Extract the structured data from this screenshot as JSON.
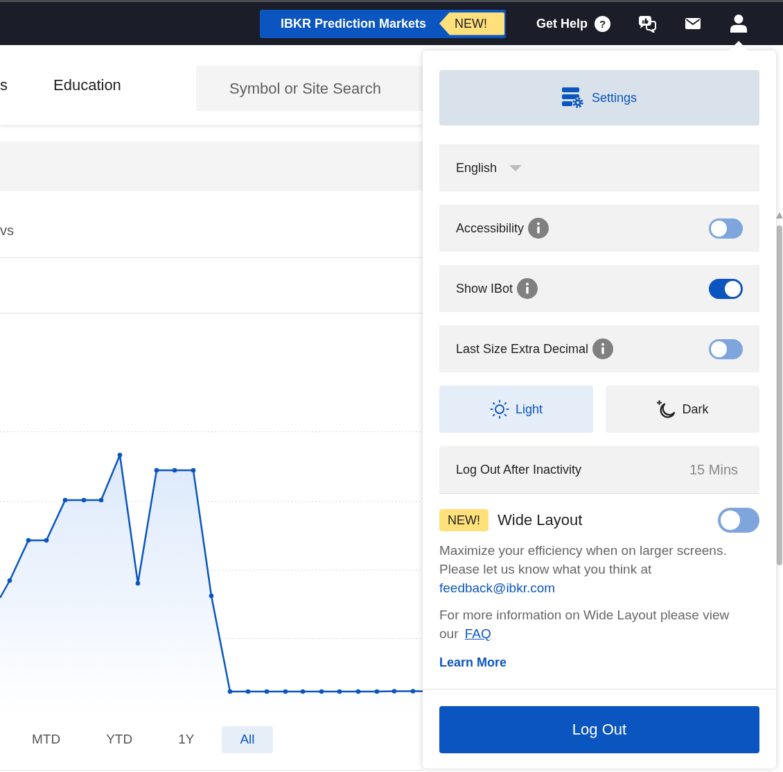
{
  "top_bar": {
    "promo_button": {
      "label": "IBKR Prediction Markets",
      "badge": "NEW!"
    },
    "help_link": {
      "label": "Get Help",
      "icon": "?"
    }
  },
  "nav": {
    "items": [
      {
        "label": "s"
      },
      {
        "label": "Education"
      }
    ],
    "search": {
      "placeholder": "Symbol or Site Search"
    }
  },
  "content": {
    "label_fragment": "vs",
    "range_buttons": [
      {
        "label": "MTD",
        "selected": false
      },
      {
        "label": "YTD",
        "selected": false
      },
      {
        "label": "1Y",
        "selected": false
      },
      {
        "label": "All",
        "selected": true
      }
    ]
  },
  "settings_panel": {
    "settings_button": {
      "label": "Settings"
    },
    "language": {
      "value": "English"
    },
    "toggles": [
      {
        "label": "Accessibility",
        "on": false
      },
      {
        "label": "Show IBot",
        "on": true
      },
      {
        "label": "Last Size Extra Decimal",
        "on": false
      }
    ],
    "theme": [
      {
        "label": "Light",
        "kind": "sun",
        "selected": true
      },
      {
        "label": "Dark",
        "kind": "moon",
        "selected": false
      }
    ],
    "inactivity": {
      "label": "Log Out After Inactivity",
      "value": "15 Mins"
    },
    "wide_layout": {
      "badge": "NEW!",
      "title": "Wide Layout",
      "on": false,
      "description": "Maximize your efficiency when on larger screens. Please let us know what you think at",
      "email": "feedback@ibkr.com",
      "info": "For more information on Wide Layout please view our",
      "faq_link": "FAQ",
      "learn_more": "Learn More"
    },
    "logout_button": {
      "label": "Log Out"
    }
  }
}
